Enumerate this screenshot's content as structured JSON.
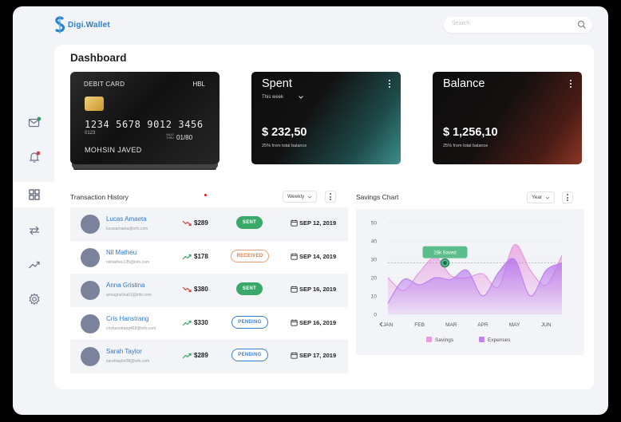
{
  "app": {
    "name": "Digi.Wallet"
  },
  "search": {
    "placeholder": "Search"
  },
  "sidebar": {
    "items": [
      "mail-icon",
      "bell-icon",
      "grid-icon",
      "transfer-icon",
      "trending-icon",
      "settings-icon"
    ],
    "active": "grid-icon"
  },
  "dashboard": {
    "title": "Dashboard"
  },
  "debit_card": {
    "label": "DEBIT CARD",
    "bank": "HBL",
    "number": "1234 5678 9012 3456",
    "sub": "0123",
    "valid_label": "VALID THRU",
    "expiry": "01/80",
    "holder": "MOHSIN JAVED"
  },
  "spent": {
    "title": "Spent",
    "period": "This week",
    "amount": "$ 232,50",
    "note": "25% from total balance",
    "gradient": "#3d8e8b"
  },
  "balance": {
    "title": "Balance",
    "amount": "$ 1,256,10",
    "note": "25% from total balance",
    "gradient": "#8c3624"
  },
  "transactions": {
    "title": "Transaction History",
    "filter": "Weekly",
    "rows": [
      {
        "name": "Lucas Amaeta",
        "email": "lucasamaeta@info.com",
        "trend": "down",
        "amount": "$289",
        "status": "SENT",
        "date": "SEP 12, 2019"
      },
      {
        "name": "Nil Matheu",
        "email": "nilmatheu135@info.com",
        "trend": "up",
        "amount": "$178",
        "status": "RECEIVED",
        "date": "SEP 14, 2019"
      },
      {
        "name": "Anna Gristina",
        "email": "annagristina61@info.com",
        "trend": "down",
        "amount": "$380",
        "status": "SENT",
        "date": "SEP 16, 2019"
      },
      {
        "name": "Cris Hanstrang",
        "email": "crishanstrang468@info.com",
        "trend": "up",
        "amount": "$330",
        "status": "PENDING",
        "date": "SEP 16, 2019"
      },
      {
        "name": "Sarah Taylor",
        "email": "sarahtaylor98@info.com",
        "trend": "up",
        "amount": "$289",
        "status": "PENDING",
        "date": "SEP 17, 2019"
      }
    ]
  },
  "savings": {
    "title": "Savings Chart",
    "filter": "Year",
    "tooltip": "28k Saved"
  },
  "chart_data": {
    "type": "area",
    "title": "Savings Chart",
    "categories": [
      "JAN",
      "FEB",
      "MAR",
      "APR",
      "MAY",
      "JUN"
    ],
    "ylim": [
      0,
      50
    ],
    "yticks": [
      0,
      10,
      20,
      30,
      40,
      50
    ],
    "grid": true,
    "legend": "bottom",
    "series": [
      {
        "name": "Savings",
        "color": "#e79be0",
        "x": [
          0,
          0.5,
          1,
          1.5,
          2,
          2.5,
          3,
          3.5,
          4,
          4.5,
          5,
          5.5
        ],
        "values": [
          20,
          13,
          23,
          31,
          21,
          20,
          22,
          15,
          38,
          24,
          16,
          32
        ]
      },
      {
        "name": "Expenses",
        "color": "#c183ee",
        "x": [
          0,
          0.5,
          1,
          1.5,
          2,
          2.5,
          3,
          3.5,
          4,
          4.5,
          5,
          5.5
        ],
        "values": [
          6,
          19,
          16,
          20,
          19,
          24,
          10,
          23,
          30,
          10,
          24,
          28
        ]
      }
    ]
  }
}
